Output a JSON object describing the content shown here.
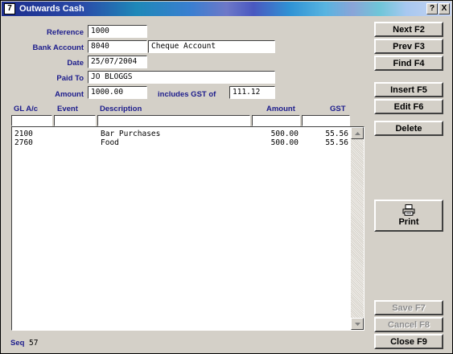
{
  "window": {
    "title": "Outwards Cash",
    "app_icon": "7",
    "help_glyph": "?",
    "close_glyph": "X"
  },
  "form": {
    "reference_label": "Reference",
    "reference_value": "1000",
    "bank_account_label": "Bank Account",
    "bank_account_code": "8040",
    "bank_account_name": "Cheque Account",
    "date_label": "Date",
    "date_value": "25/07/2004",
    "paid_to_label": "Paid To",
    "paid_to_value": "JO BLOGGS",
    "amount_label": "Amount",
    "amount_value": "1000.00",
    "gst_label": "includes GST of",
    "gst_value": "111.12"
  },
  "table": {
    "columns": [
      "GL A/c",
      "Event",
      "Description",
      "Amount",
      "GST"
    ],
    "rows": [
      {
        "gl": "2100",
        "event": "",
        "description": "Bar Purchases",
        "amount": "500.00",
        "gst": "55.56"
      },
      {
        "gl": "2760",
        "event": "",
        "description": "Food",
        "amount": "500.00",
        "gst": "55.56"
      }
    ]
  },
  "buttons": {
    "next": "Next F2",
    "prev": "Prev F3",
    "find": "Find F4",
    "insert": "Insert F5",
    "edit": "Edit F6",
    "delete": "Delete",
    "print": "Print",
    "save": "Save F7",
    "cancel": "Cancel F8",
    "close": "Close F9"
  },
  "status": {
    "seq_label": "Seq",
    "seq_value": "57"
  },
  "icons": {
    "app": "app-icon",
    "help": "help-icon",
    "close": "close-icon",
    "printer": "printer-icon",
    "scroll_up": "scroll-up-icon",
    "scroll_down": "scroll-down-icon"
  }
}
